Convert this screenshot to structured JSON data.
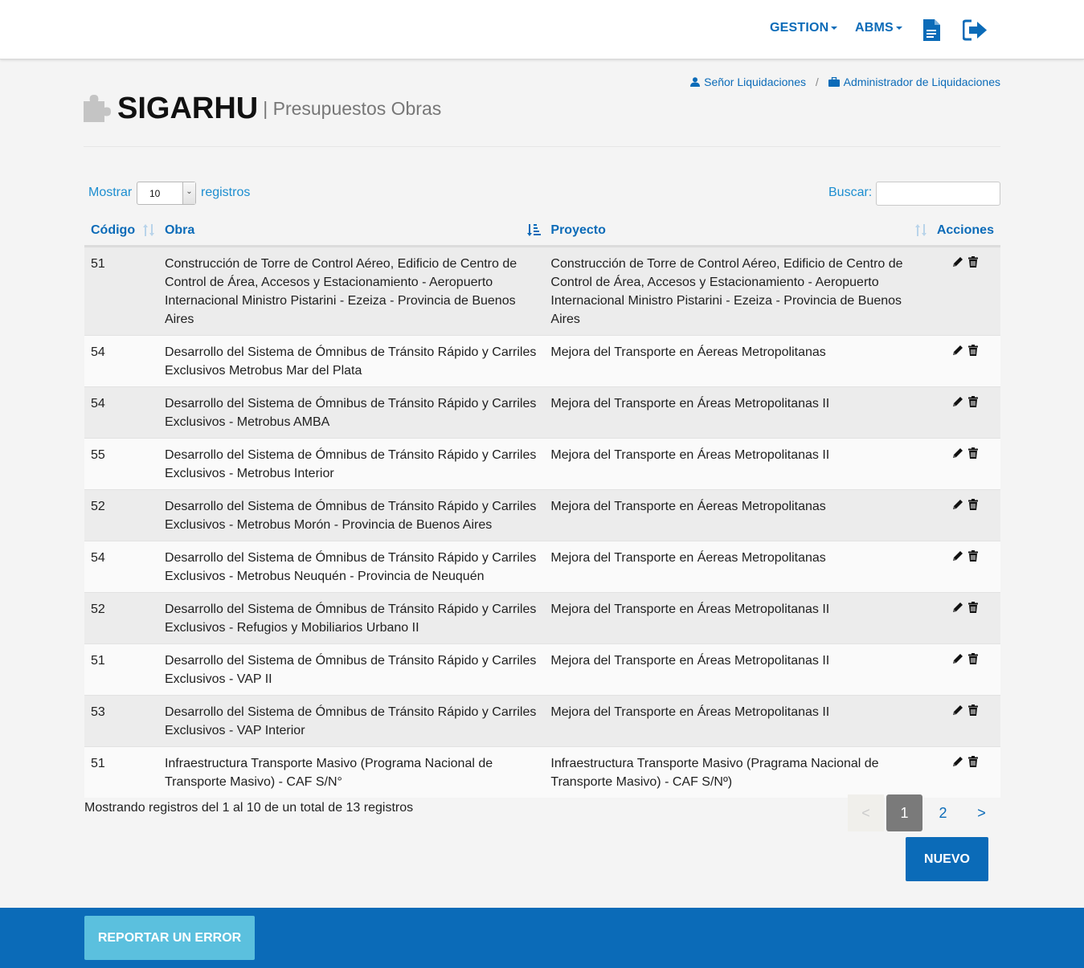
{
  "nav": {
    "gestion_label": "GESTION",
    "abms_label": "ABMS",
    "document_icon": "document-icon",
    "logout_icon": "logout-icon"
  },
  "breadcrumb": {
    "user_label": "Señor Liquidaciones",
    "separator": "/",
    "role_label": "Administrador de Liquidaciones"
  },
  "header": {
    "app_title": "SIGARHU",
    "subtitle": "| Presupuestos Obras"
  },
  "controls": {
    "show_label": "Mostrar",
    "page_size": "10",
    "records_label": "registros",
    "search_label": "Buscar:",
    "search_value": ""
  },
  "table": {
    "columns": [
      "Código",
      "Obra",
      "Proyecto",
      "Acciones"
    ],
    "rows": [
      {
        "codigo": "51",
        "obra": "Construcción de Torre de Control Aéreo, Edificio de Centro de Control de Área, Accesos y Estacionamiento - Aeropuerto Internacional Ministro Pistarini - Ezeiza - Provincia de Buenos Aires",
        "proyecto": "Construcción de Torre de Control Aéreo, Edificio de Centro de Control de Área, Accesos y Estacionamiento - Aeropuerto Internacional Ministro Pistarini - Ezeiza - Provincia de Buenos Aires"
      },
      {
        "codigo": "54",
        "obra": "Desarrollo del Sistema de Ómnibus de Tránsito Rápido y Carriles Exclusivos Metrobus Mar del Plata",
        "proyecto": "Mejora del Transporte en Áereas Metropolitanas"
      },
      {
        "codigo": "54",
        "obra": "Desarrollo del Sistema de Ómnibus de Tránsito Rápido y Carriles Exclusivos - Metrobus AMBA",
        "proyecto": "Mejora del Transporte en Áreas Metropolitanas II"
      },
      {
        "codigo": "55",
        "obra": "Desarrollo del Sistema de Ómnibus de Tránsito Rápido y Carriles Exclusivos - Metrobus Interior",
        "proyecto": "Mejora del Transporte en Áreas Metropolitanas II"
      },
      {
        "codigo": "52",
        "obra": "Desarrollo del Sistema de Ómnibus de Tránsito Rápido y Carriles Exclusivos - Metrobus Morón - Provincia de Buenos Aires",
        "proyecto": "Mejora del Transporte en Áereas Metropolitanas"
      },
      {
        "codigo": "54",
        "obra": "Desarrollo del Sistema de Ómnibus de Tránsito Rápido y Carriles Exclusivos - Metrobus Neuquén - Provincia de Neuquén",
        "proyecto": "Mejora del Transporte en Áereas Metropolitanas"
      },
      {
        "codigo": "52",
        "obra": "Desarrollo del Sistema de Ómnibus de Tránsito Rápido y Carriles Exclusivos - Refugios y Mobiliarios Urbano II",
        "proyecto": "Mejora del Transporte en Áreas Metropolitanas II"
      },
      {
        "codigo": "51",
        "obra": "Desarrollo del Sistema de Ómnibus de Tránsito Rápido y Carriles Exclusivos - VAP II",
        "proyecto": "Mejora del Transporte en Áreas Metropolitanas II"
      },
      {
        "codigo": "53",
        "obra": "Desarrollo del Sistema de Ómnibus de Tránsito Rápido y Carriles Exclusivos - VAP Interior",
        "proyecto": "Mejora del Transporte en Áreas Metropolitanas II"
      },
      {
        "codigo": "51",
        "obra": "Infraestructura Transporte Masivo (Programa Nacional de Transporte Masivo) - CAF S/N°",
        "proyecto": "Infraestructura Transporte Masivo (Pragrama Nacional de Transporte Masivo) - CAF S/Nº)"
      }
    ]
  },
  "info_text": "Mostrando registros del 1 al 10 de un total de 13 registros",
  "pagination": {
    "prev": "<",
    "pages": [
      "1",
      "2"
    ],
    "current": "1",
    "next": ">"
  },
  "buttons": {
    "nuevo": "NUEVO",
    "report": "REPORTAR UN ERROR"
  },
  "colors": {
    "primary": "#0b6bb8",
    "info": "#5bc0de",
    "background": "#f4f4f4"
  }
}
